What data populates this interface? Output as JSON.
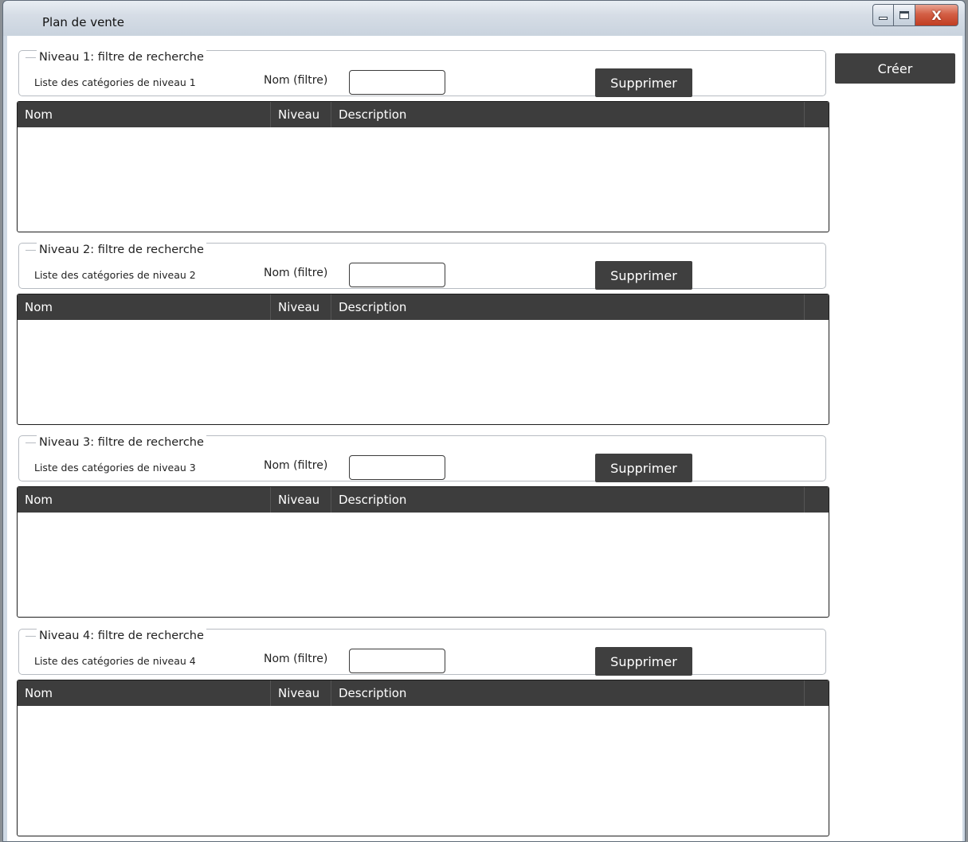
{
  "window": {
    "title": "Plan de vente",
    "controls": {
      "minimize": "minimize-icon",
      "maximize": "maximize-icon",
      "close": "close-icon",
      "close_glyph": "X"
    }
  },
  "actions": {
    "create_label": "Créer"
  },
  "levels": [
    {
      "legend": "Niveau 1: filtre de recherche",
      "list_label": "Liste des catégories de niveau 1",
      "filter_label": "Nom (filtre)",
      "filter_value": "",
      "delete_label": "Supprimer",
      "columns": [
        "Nom",
        "Niveau",
        "Description"
      ],
      "rows": []
    },
    {
      "legend": "Niveau 2: filtre de recherche",
      "list_label": "Liste des catégories de niveau 2",
      "filter_label": "Nom (filtre)",
      "filter_value": "",
      "delete_label": "Supprimer",
      "columns": [
        "Nom",
        "Niveau",
        "Description"
      ],
      "rows": []
    },
    {
      "legend": "Niveau 3: filtre de recherche",
      "list_label": "Liste des catégories de niveau 3",
      "filter_label": "Nom (filtre)",
      "filter_value": "",
      "delete_label": "Supprimer",
      "columns": [
        "Nom",
        "Niveau",
        "Description"
      ],
      "rows": []
    },
    {
      "legend": "Niveau 4: filtre de recherche",
      "list_label": "Liste des catégories de niveau 4",
      "filter_label": "Nom (filtre)",
      "filter_value": "",
      "delete_label": "Supprimer",
      "columns": [
        "Nom",
        "Niveau",
        "Description"
      ],
      "rows": []
    }
  ]
}
